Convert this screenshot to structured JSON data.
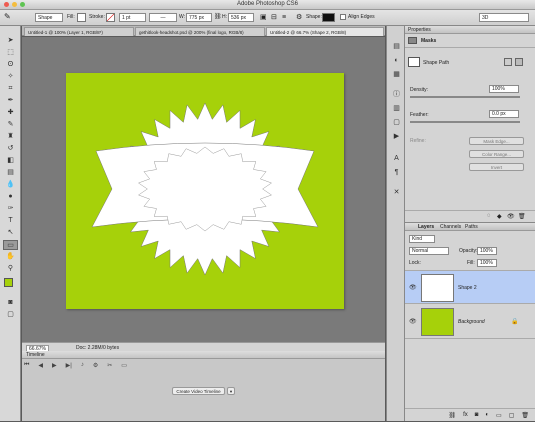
{
  "app": {
    "title": "Adobe Photoshop CS6"
  },
  "options_bar": {
    "tool_mode": "Shape",
    "fill_label": "Fill:",
    "stroke_label": "Stroke:",
    "stroke_width": "1 pt",
    "width_label": "W:",
    "width_value": "775 px",
    "height_label": "H:",
    "height_value": "536 px",
    "shape_label": "Shape:",
    "align_edges_label": "Align Edges",
    "workspace": "3D"
  },
  "tabs": [
    {
      "label": "Untitled-1 @ 100% (Layer 1, RGB/8*)"
    },
    {
      "label": "gethitlook-headshot.psd @ 200% (final logo, RGB/8)"
    },
    {
      "label": "Untitled-2 @ 66.7% (Shape 2, RGB/8)"
    }
  ],
  "status": {
    "zoom": "66.67%",
    "doc": "Doc: 2.28M/0 bytes"
  },
  "timeline": {
    "title": "Timeline",
    "create_button": "Create Video Timeline"
  },
  "properties": {
    "panel_title": "Properties",
    "section": "Masks",
    "shape_path": "Shape Path",
    "density_label": "Density:",
    "density_value": "100%",
    "feather_label": "Feather:",
    "feather_value": "0.0 px",
    "refine_label": "Refine:",
    "mask_edge_button": "Mask Edge...",
    "color_range_button": "Color Range...",
    "invert_button": "Invert"
  },
  "layers": {
    "tabs": [
      "Layers",
      "Channels",
      "Paths"
    ],
    "filter": "Kind",
    "blend_mode": "Normal",
    "opacity_label": "Opacity:",
    "opacity_value": "100%",
    "lock_label": "Lock:",
    "fill_label": "Fill:",
    "fill_value": "100%",
    "items": [
      {
        "name": "Shape 2"
      },
      {
        "name": "Background"
      }
    ]
  },
  "colors": {
    "canvas_green": "#a6d10a",
    "selected_layer": "#b7cdf5"
  }
}
